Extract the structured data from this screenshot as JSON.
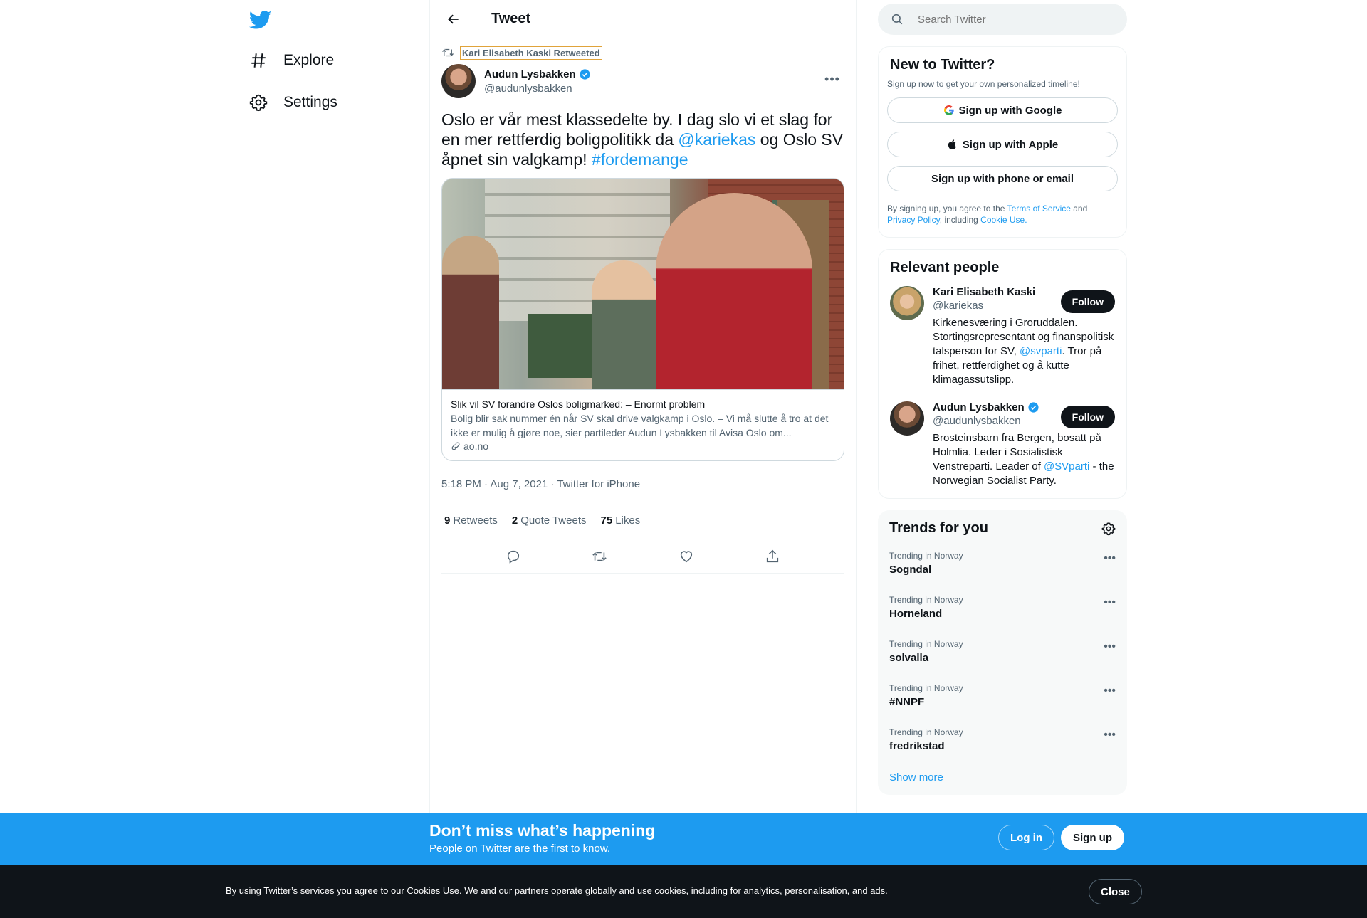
{
  "colors": {
    "brand": "#1d9bf0",
    "text": "#0f1419",
    "secondary": "#536471",
    "dark": "#0f1419"
  },
  "nav": {
    "logo_icon": "twitter-bird-icon",
    "items": [
      {
        "label": "Explore",
        "icon": "hashtag-icon"
      },
      {
        "label": "Settings",
        "icon": "gear-icon"
      }
    ]
  },
  "header": {
    "title": "Tweet",
    "back_icon": "arrow-left-icon"
  },
  "tweet": {
    "retweeted_by": "Kari Elisabeth Kaski Retweeted",
    "author_name": "Audun Lysbakken",
    "author_handle": "@audunlysbakken",
    "text_part1": "Oslo er vår mest klassedelte by. I dag slo vi et slag for en mer rettferdig boligpolitikk da ",
    "mention": "@kariekas",
    "text_part2": " og Oslo SV åpnet sin valgkamp! ",
    "hashtag": "#fordemange",
    "card": {
      "title": "Slik vil SV forandre Oslos boligmarked: – Enormt problem",
      "description": "Bolig blir sak nummer én når SV skal drive valgkamp i Oslo. – Vi må slutte å tro at det ikke er mulig å gjøre noe, sier partileder Audun Lysbakken til Avisa Oslo om...",
      "domain": "ao.no"
    },
    "timestamp": "5:18 PM · Aug 7, 2021 · Twitter for iPhone",
    "stats": {
      "retweets_count": "9",
      "retweets_label": "Retweets",
      "quotes_count": "2",
      "quotes_label": "Quote Tweets",
      "likes_count": "75",
      "likes_label": "Likes"
    }
  },
  "search": {
    "placeholder": "Search Twitter"
  },
  "new_to_twitter": {
    "title": "New to Twitter?",
    "subtitle": "Sign up now to get your own personalized timeline!",
    "google": "Sign up with Google",
    "apple": "Sign up with Apple",
    "phone": "Sign up with phone or email",
    "legal_1": "By signing up, you agree to the ",
    "terms": "Terms of Service",
    "legal_2": " and ",
    "privacy": "Privacy Policy",
    "legal_3": ", including ",
    "cookie": "Cookie Use."
  },
  "relevant": {
    "title": "Relevant people",
    "follow_label": "Follow",
    "p1": {
      "name": "Kari Elisabeth Kaski",
      "handle": "@kariekas",
      "bio_1": "Kirkenesværing i Groruddalen. Stortingsrepresentant og finanspolitisk talsperson for SV, ",
      "bio_link": "@svparti",
      "bio_2": ". Tror på frihet, rettferdighet og å kutte klimagassutslipp."
    },
    "p2": {
      "name": "Audun Lysbakken",
      "handle": "@audunlysbakken",
      "bio_1": "Brosteinsbarn fra Bergen, bosatt på Holmlia. Leder i Sosialistisk Venstreparti. Leader of ",
      "bio_link": "@SVparti",
      "bio_2": " - the Norwegian Socialist Party."
    }
  },
  "trends": {
    "title": "Trends for you",
    "items": [
      {
        "context": "Trending in Norway",
        "name": "Sogndal"
      },
      {
        "context": "Trending in Norway",
        "name": "Horneland"
      },
      {
        "context": "Trending in Norway",
        "name": "solvalla"
      },
      {
        "context": "Trending in Norway",
        "name": "#NNPF"
      },
      {
        "context": "Trending in Norway",
        "name": "fredrikstad"
      }
    ],
    "show_more": "Show more"
  },
  "banner": {
    "title": "Don’t miss what’s happening",
    "subtitle": "People on Twitter are the first to know.",
    "login": "Log in",
    "signup": "Sign up"
  },
  "cookie_bar": {
    "text": "By using Twitter’s services you agree to our Cookies Use. We and our partners operate globally and use cookies, including for analytics, personalisation, and ads.",
    "close": "Close"
  }
}
